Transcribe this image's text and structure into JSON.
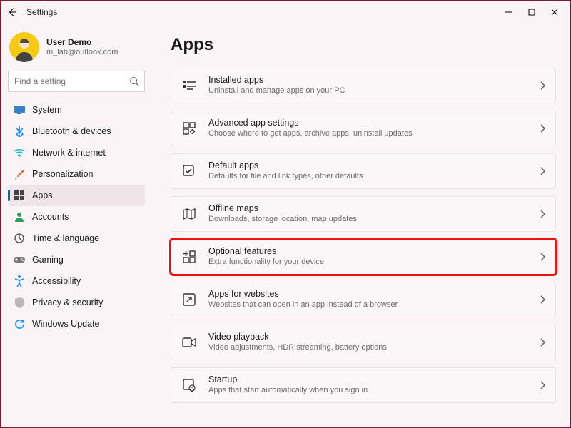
{
  "window": {
    "title": "Settings"
  },
  "user": {
    "name": "User Demo",
    "email": "m_lab@outlook.com"
  },
  "search": {
    "placeholder": "Find a setting"
  },
  "sidebar": {
    "items": [
      {
        "label": "System"
      },
      {
        "label": "Bluetooth & devices"
      },
      {
        "label": "Network & internet"
      },
      {
        "label": "Personalization"
      },
      {
        "label": "Apps"
      },
      {
        "label": "Accounts"
      },
      {
        "label": "Time & language"
      },
      {
        "label": "Gaming"
      },
      {
        "label": "Accessibility"
      },
      {
        "label": "Privacy & security"
      },
      {
        "label": "Windows Update"
      }
    ],
    "selected": 4
  },
  "page": {
    "title": "Apps"
  },
  "cards": [
    {
      "title": "Installed apps",
      "sub": "Uninstall and manage apps on your PC"
    },
    {
      "title": "Advanced app settings",
      "sub": "Choose where to get apps, archive apps, uninstall updates"
    },
    {
      "title": "Default apps",
      "sub": "Defaults for file and link types, other defaults"
    },
    {
      "title": "Offline maps",
      "sub": "Downloads, storage location, map updates"
    },
    {
      "title": "Optional features",
      "sub": "Extra functionality for your device",
      "highlight": true
    },
    {
      "title": "Apps for websites",
      "sub": "Websites that can open in an app instead of a browser"
    },
    {
      "title": "Video playback",
      "sub": "Video adjustments, HDR streaming, battery options"
    },
    {
      "title": "Startup",
      "sub": "Apps that start automatically when you sign in"
    }
  ]
}
